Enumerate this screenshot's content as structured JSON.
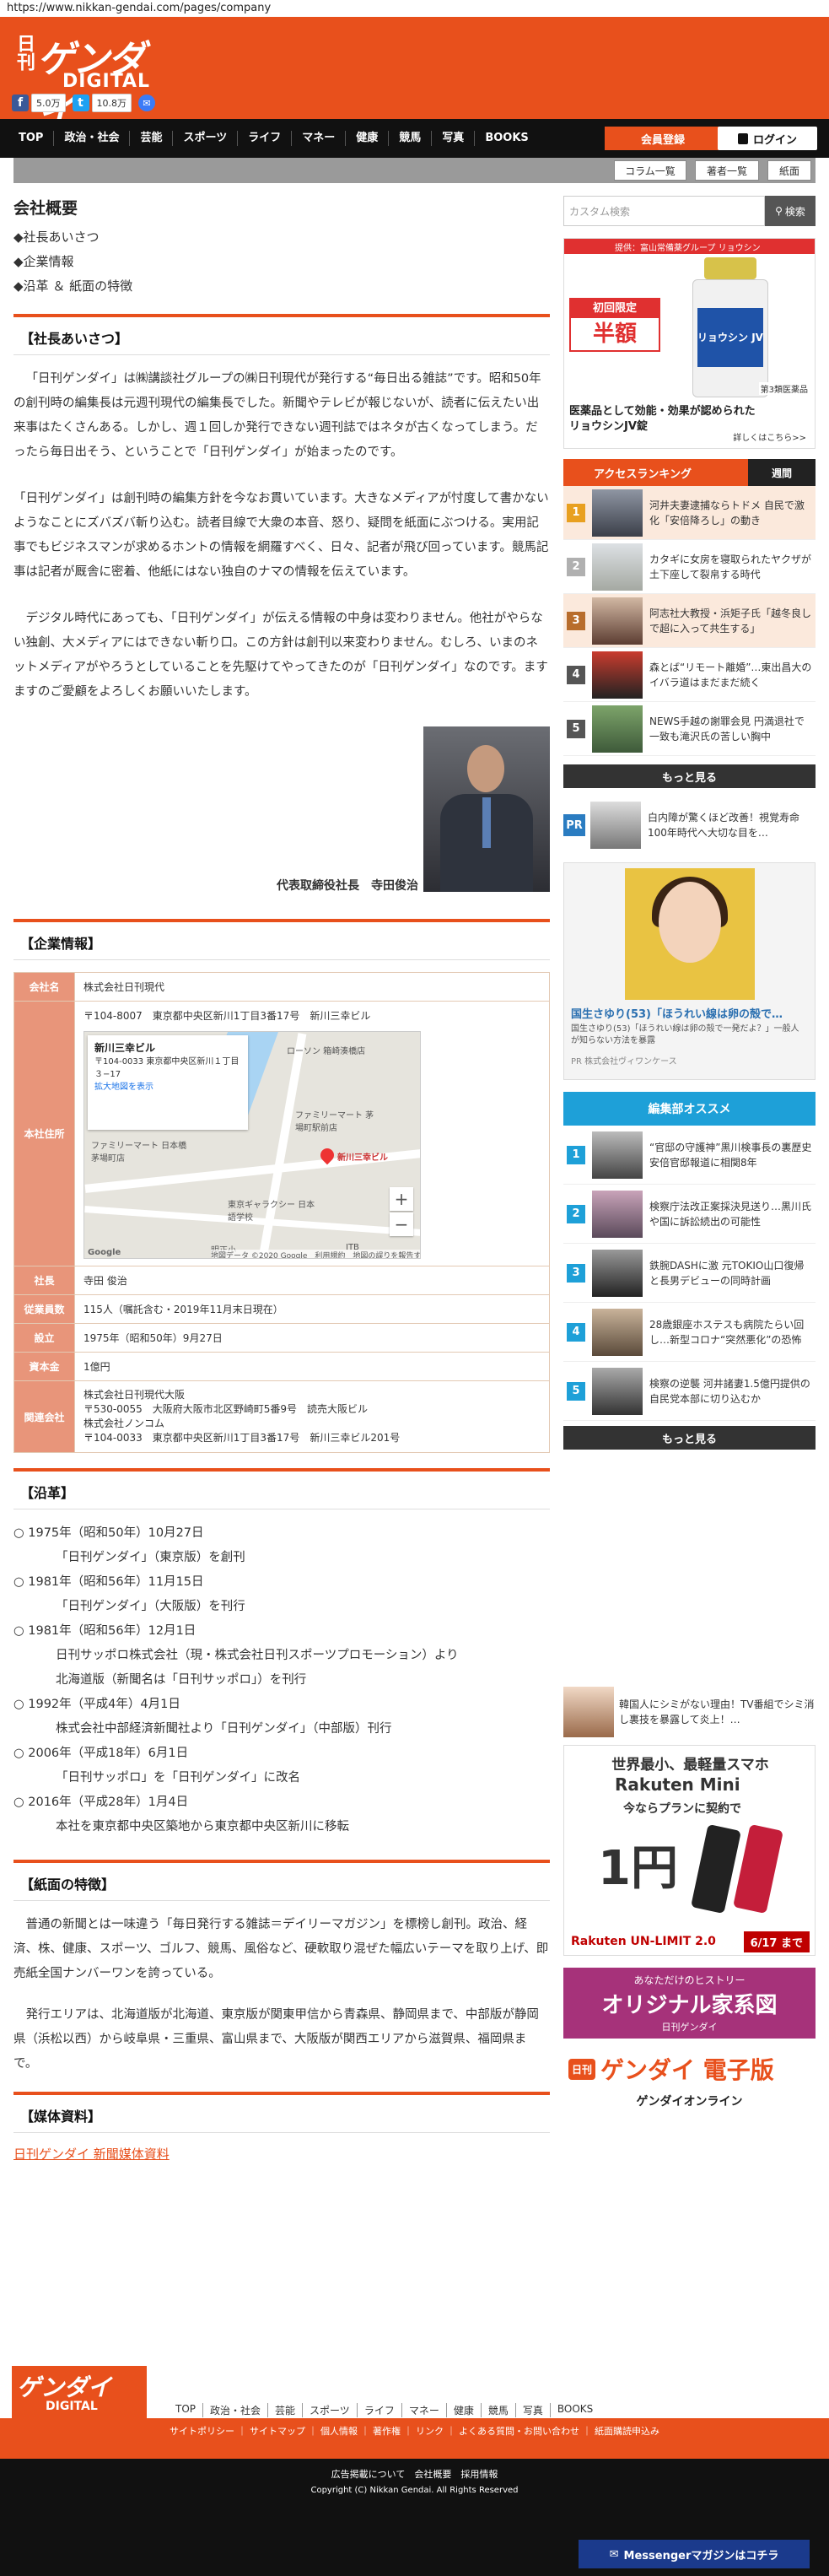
{
  "url": "https://www.nikkan-gendai.com/pages/company",
  "logo": {
    "top": "日刊",
    "main": "ゲンダイ",
    "sub": "DIGITAL"
  },
  "social": {
    "facebook_count": "5.0万",
    "twitter_count": "10.8万"
  },
  "nav": [
    "TOP",
    "政治・社会",
    "芸能",
    "スポーツ",
    "ライフ",
    "マネー",
    "健康",
    "競馬",
    "写真",
    "BOOKS"
  ],
  "header_buttons": {
    "register": "会員登録",
    "login": "ログイン"
  },
  "subbar": [
    "コラム一覧",
    "著者一覧",
    "紙面"
  ],
  "page_title": "会社概要",
  "toc": [
    "◆社長あいさつ",
    "◆企業情報",
    "◆沿革 ＆ 紙面の特徴"
  ],
  "greeting": {
    "heading": "【社長あいさつ】",
    "paragraphs": [
      "「日刊ゲンダイ」は㈱講談社グループの㈱日刊現代が発行する“毎日出る雑誌”です。昭和50年の創刊時の編集長は元週刊現代の編集長でした。新聞やテレビが報じないが、読者に伝えたい出来事はたくさんある。しかし、週１回しか発行できない週刊誌ではネタが古くなってしまう。だったら毎日出そう、ということで「日刊ゲンダイ」が始まったのです。",
      "「日刊ゲンダイ」は創刊時の編集方針を今なお貫いています。大きなメディアが忖度して書かないようなことにズバズバ斬り込む。読者目線で大衆の本音、怒り、疑問を紙面にぶつける。実用記事でもビジネスマンが求めるホントの情報を網羅すべく、日々、記者が飛び回っています。競馬記事は記者が厩舎に密着、他紙にはない独自のナマの情報を伝えています。",
      "　デジタル時代にあっても、「日刊ゲンダイ」が伝える情報の中身は変わりません。他社がやらない独創、大メディアにはできない斬り口。この方針は創刊以来変わりません。むしろ、いまのネットメディアがやろうとしていることを先駆けてやってきたのが「日刊ゲンダイ」なのです。ますますのご愛顧をよろしくお願いいたします。"
    ],
    "signature": "代表取締役社長　寺田俊治"
  },
  "company": {
    "heading": "【企業情報】",
    "rows": [
      {
        "label": "会社名",
        "value": "株式会社日刊現代"
      },
      {
        "label": "本社住所",
        "value": "〒104-8007　東京都中央区新川1丁目3番17号　新川三幸ビル"
      },
      {
        "label": "社長",
        "value": "寺田 俊治"
      },
      {
        "label": "従業員数",
        "value": "115人（嘱託含む・2019年11月末日現在）"
      },
      {
        "label": "設立",
        "value": "1975年（昭和50年）9月27日"
      },
      {
        "label": "資本金",
        "value": "1億円"
      },
      {
        "label": "関連会社",
        "value": "株式会社日刊現代大阪\n〒530-0055　大阪府大阪市北区野崎町5番9号　読売大阪ビル\n株式会社ノンコム\n〒104-0033　東京都中央区新川1丁目3番17号　新川三幸ビル201号"
      }
    ],
    "map": {
      "place": "新川三幸ビル",
      "addr": "〒104-0033 東京都中央区新川１丁目３−17",
      "link": "拡大地図を表示",
      "pin_label": "新川三幸ビル",
      "labels": [
        "ローソン 箱崎湊橋店",
        "ファミリーマート 茅場町駅前店",
        "ファミリーマート 日本橋茅場町店",
        "東京ギャラクシー 日本語学校",
        "明正小",
        "ITB"
      ],
      "footer": "地図データ ©2020 Google　利用規約　地図の誤りを報告する",
      "google": "Google"
    }
  },
  "history": {
    "heading": "【沿革】",
    "items": [
      {
        "date": "○ 1975年（昭和50年）10月27日",
        "text": "「日刊ゲンダイ」（東京版）を創刊"
      },
      {
        "date": "○ 1981年（昭和56年）11月15日",
        "text": "「日刊ゲンダイ」（大阪版）を刊行"
      },
      {
        "date": "○ 1981年（昭和56年）12月1日",
        "text": "日刊サッポロ株式会社（現・株式会社日刊スポーツプロモーション）より\n北海道版（新聞名は「日刊サッポロ」）を刊行"
      },
      {
        "date": "○ 1992年（平成4年）4月1日",
        "text": "株式会社中部経済新聞社より「日刊ゲンダイ」（中部版）刊行"
      },
      {
        "date": "○ 2006年（平成18年）6月1日",
        "text": "「日刊サッポロ」を「日刊ゲンダイ」に改名"
      },
      {
        "date": "○ 2016年（平成28年）1月4日",
        "text": "本社を東京都中央区築地から東京都中央区新川に移転"
      }
    ]
  },
  "features": {
    "heading": "【紙面の特徴】",
    "paragraphs": [
      "普通の新聞とは一味違う「毎日発行する雑誌＝デイリーマガジン」を標榜し創刊。政治、経済、株、健康、スポーツ、ゴルフ、競馬、風俗など、硬軟取り混ぜた幅広いテーマを取り上げ、即売紙全国ナンバーワンを誇っている。",
      "発行エリアは、北海道版が北海道、東京版が関東甲信から青森県、静岡県まで、中部版が静岡県（浜松以西）から岐阜県・三重県、富山県まで、大阪版が関西エリアから滋賀県、福岡県まで。"
    ]
  },
  "media": {
    "heading": "【媒体資料】",
    "link": "日刊ゲンダイ 新聞媒体資料"
  },
  "sidebar": {
    "search_placeholder": "カスタム検索",
    "search_button": "検索",
    "ad1": {
      "top": "提供：富山常備薬グループ リョウシンJV錠",
      "badge_top": "初回限定",
      "badge_main": "半額",
      "label": "第3類医薬品",
      "brand": "リョウシン JV",
      "text1": "医薬品として効能・効果が認められた",
      "text2": "リョウシンJV錠",
      "more": "詳しくはこちら>>"
    },
    "ranking_tab": "アクセスランキング",
    "ranking_period": "週間",
    "ranking": [
      "河井夫妻逮捕ならトドメ 自民で激化「安倍降ろし」の動き",
      "カタギに女房を寝取られたヤクザが土下座して裂帛する時代",
      "阿志社大教授・浜矩子氏「越冬良しで超に入って共生する」",
      "森とば“リモート離婚”…東出昌大のイバラ道はまだまだ続く",
      "NEWS手越の謝罪会見 円満退社で一致も滝沢氏の苦しい胸中"
    ],
    "more": "もっと見る",
    "pr_text": "白内障が驚くほど改善！視覚寿命100年時代へ大切な目を…",
    "pr_label": "PR",
    "ad2": {
      "title": "国生さゆり(53)「ほうれい線は卵の殻で…",
      "desc": "国生さゆり(53)「ほうれい線は卵の殻で一発だよ？」一般人が知らない方法を暴露",
      "sponsor": "PR 株式会社ヴィワンケース"
    },
    "osusume_title": "編集部オススメ",
    "osusume": [
      "“官邸の守護神”黒川検事長の裏歴史 安倍官邸報道に相関8年",
      "検察庁法改正案採決見送り…黒川氏や国に訴訟続出の可能性",
      "鉄腕DASHに激 元TOKIO山口復帰と長男デビューの同時計画",
      "28歳銀座ホステスも病院たらい回し…新型コロナ“突然悪化”の恐怖",
      "検察の逆襲 河井諸妻1.5億円提供の自民党本部に切り込むか"
    ],
    "ad3": "韓国人にシミがない理由！TV番組でシミ消し裏技を暴露して炎上！…",
    "ad4": {
      "line1": "世界最小、最軽量スマホ",
      "brand": "Rakuten Mini",
      "line2": "今ならプランに契約で",
      "price": "1円",
      "plan": "Rakuten UN-LIMIT 2.0",
      "date": "6/17 まで"
    },
    "ad5": {
      "small": "あなただけのヒストリー",
      "main": "オリジナル家系図",
      "sub": "日刊ゲンダイ"
    },
    "ad6": {
      "main": "ゲンダイ 電子版",
      "sub": "ゲンダイオンライン"
    }
  },
  "footer": {
    "nav": [
      "TOP",
      "政治・社会",
      "芸能",
      "スポーツ",
      "ライフ",
      "マネー",
      "健康",
      "競馬",
      "写真",
      "BOOKS"
    ],
    "links": "サイトポリシー ｜ サイトマップ ｜ 個人情報 ｜ 著作権 ｜ リンク ｜ よくある質問・お問い合わせ ｜ 紙面購読申込み",
    "links2": "広告掲載について　会社概要　採用情報",
    "copyright": "Copyright (C) Nikkan Gendai. All Rights Reserved",
    "messenger": "Messengerマガジンはコチラ"
  }
}
